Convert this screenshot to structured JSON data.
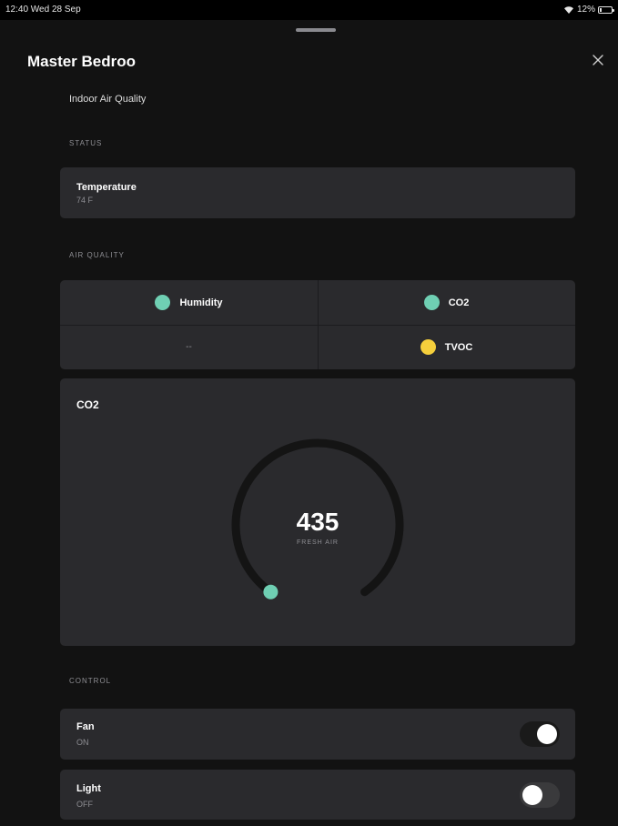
{
  "status_bar": {
    "time": "12:40  Wed 28 Sep",
    "battery": "12%"
  },
  "header": {
    "title": "Master Bedroo",
    "close_icon": "close-icon"
  },
  "subtitle": "Indoor Air Quality",
  "status_section": {
    "label": "STATUS",
    "temperature": {
      "title": "Temperature",
      "value": "74 F"
    }
  },
  "air_quality": {
    "label": "AIR QUALITY",
    "cells": [
      {
        "label": "Humidity",
        "color": "#6fcfb3"
      },
      {
        "label": "CO2",
        "color": "#6fcfb3"
      },
      {
        "label": "--",
        "color": ""
      },
      {
        "label": "TVOC",
        "color": "#f5cf3c"
      }
    ]
  },
  "gauge": {
    "title": "CO2",
    "value": "435",
    "status": "FRESH AIR",
    "level": 0.0,
    "color": "#6fcfb3"
  },
  "control": {
    "label": "CONTROL",
    "fan": {
      "title": "Fan",
      "state": "ON",
      "on": true
    },
    "light": {
      "title": "Light",
      "state": "OFF",
      "on": false
    }
  },
  "colors": {
    "accent_green": "#6fcfb3",
    "accent_yellow": "#f5cf3c",
    "card_bg": "#2a2a2d",
    "background": "#121212"
  }
}
